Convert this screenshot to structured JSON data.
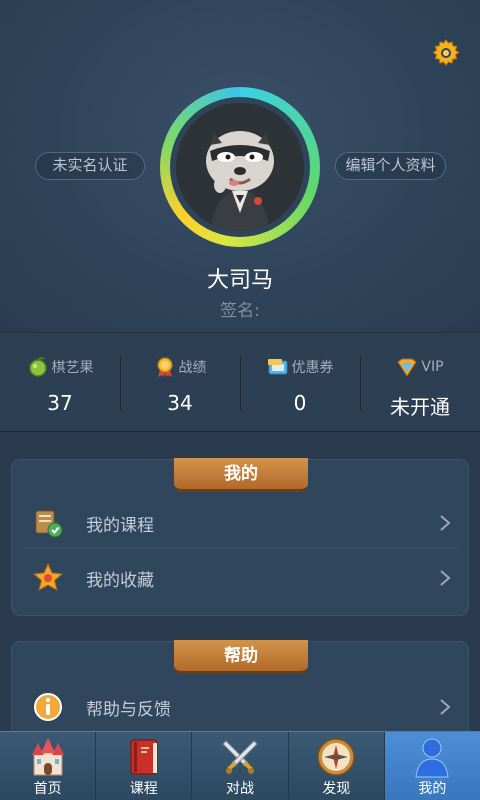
{
  "header": {
    "left_pill": "未实名认证",
    "right_pill": "编辑个人资料",
    "username": "大司马",
    "signature_label": "签名:"
  },
  "stats": [
    {
      "label": "棋艺果",
      "value": "37",
      "icon": "fruit-icon"
    },
    {
      "label": "战绩",
      "value": "34",
      "icon": "medal-icon"
    },
    {
      "label": "优惠券",
      "value": "0",
      "icon": "coupon-icon"
    },
    {
      "label": "VIP",
      "value": "未开通",
      "icon": "vip-badge-icon"
    }
  ],
  "sections": {
    "mine": {
      "title": "我的",
      "items": [
        {
          "label": "我的课程",
          "icon": "course-icon"
        },
        {
          "label": "我的收藏",
          "icon": "star-medal-icon"
        }
      ]
    },
    "help": {
      "title": "帮助",
      "items": [
        {
          "label": "帮助与反馈",
          "icon": "info-icon"
        }
      ]
    }
  },
  "tabbar": {
    "items": [
      {
        "label": "首页",
        "icon": "castle-icon"
      },
      {
        "label": "课程",
        "icon": "book-icon"
      },
      {
        "label": "对战",
        "icon": "crossed-swords-icon"
      },
      {
        "label": "发现",
        "icon": "compass-icon"
      },
      {
        "label": "我的",
        "icon": "person-icon",
        "active": true
      }
    ]
  },
  "colors": {
    "background": "#2a3b4f",
    "accent_gold": "#f5b21c",
    "tab_active": "#4d8fd6",
    "section_header": "#c47d38"
  }
}
